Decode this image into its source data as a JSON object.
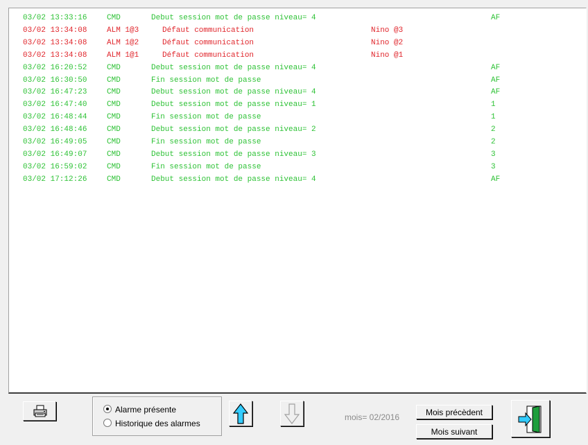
{
  "log": [
    {
      "time": "03/02 13:33:16",
      "type": "CMD",
      "message": "Debut session mot de passe niveau= 4",
      "source": "",
      "level": "AF",
      "kind": "cmd"
    },
    {
      "time": "03/02 13:34:08",
      "type": "ALM 1@3",
      "message": "Défaut communication",
      "source": "Nino @3",
      "level": "",
      "kind": "alm"
    },
    {
      "time": "03/02 13:34:08",
      "type": "ALM 1@2",
      "message": "Défaut communication",
      "source": "Nino @2",
      "level": "",
      "kind": "alm"
    },
    {
      "time": "03/02 13:34:08",
      "type": "ALM 1@1",
      "message": "Défaut communication",
      "source": "Nino @1",
      "level": "",
      "kind": "alm"
    },
    {
      "time": "03/02 16:20:52",
      "type": "CMD",
      "message": "Debut session mot de passe niveau= 4",
      "source": "",
      "level": "AF",
      "kind": "cmd"
    },
    {
      "time": "03/02 16:30:50",
      "type": "CMD",
      "message": "Fin session mot de passe",
      "source": "",
      "level": "AF",
      "kind": "cmd"
    },
    {
      "time": "03/02 16:47:23",
      "type": "CMD",
      "message": "Debut session mot de passe niveau= 4",
      "source": "",
      "level": "AF",
      "kind": "cmd"
    },
    {
      "time": "03/02 16:47:40",
      "type": "CMD",
      "message": "Debut session mot de passe niveau= 1",
      "source": "",
      "level": "1",
      "kind": "cmd"
    },
    {
      "time": "03/02 16:48:44",
      "type": "CMD",
      "message": "Fin session mot de passe",
      "source": "",
      "level": "1",
      "kind": "cmd"
    },
    {
      "time": "03/02 16:48:46",
      "type": "CMD",
      "message": "Debut session mot de passe niveau= 2",
      "source": "",
      "level": "2",
      "kind": "cmd"
    },
    {
      "time": "03/02 16:49:05",
      "type": "CMD",
      "message": "Fin session mot de passe",
      "source": "",
      "level": "2",
      "kind": "cmd"
    },
    {
      "time": "03/02 16:49:07",
      "type": "CMD",
      "message": "Debut session mot de passe niveau= 3",
      "source": "",
      "level": "3",
      "kind": "cmd"
    },
    {
      "time": "03/02 16:59:02",
      "type": "CMD",
      "message": "Fin session mot de passe",
      "source": "",
      "level": "3",
      "kind": "cmd"
    },
    {
      "time": "03/02 17:12:26",
      "type": "CMD",
      "message": "Debut session mot de passe niveau= 4",
      "source": "",
      "level": "AF",
      "kind": "cmd"
    }
  ],
  "colors": {
    "cmd": "#2ec236",
    "alm": "#e0262c"
  },
  "controls": {
    "radio_present": "Alarme présente",
    "radio_history": "Historique des alarmes",
    "radio_selected": "present",
    "mois_label": "mois= 02/2016",
    "prev_month": "Mois précèdent",
    "next_month": "Mois suivant"
  },
  "icons": {
    "print": "printer-icon",
    "up": "arrow-up-icon",
    "down": "arrow-down-icon",
    "exit": "exit-door-icon"
  }
}
